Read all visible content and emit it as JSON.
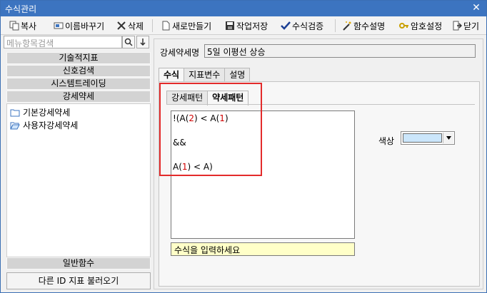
{
  "window": {
    "title": "수식관리"
  },
  "toolbar": {
    "copy": "복사",
    "rename": "이름바꾸기",
    "delete": "삭제",
    "new": "새로만들기",
    "save": "작업저장",
    "validate": "수식검증",
    "func_help": "함수설명",
    "password": "암호설정",
    "close": "닫기"
  },
  "search": {
    "placeholder": "메뉴항목검색"
  },
  "categories": [
    "기술적지표",
    "신호검색",
    "시스템트레이딩",
    "강세약세"
  ],
  "tree": [
    {
      "label": "기본강세약세"
    },
    {
      "label": "사용자강세약세"
    }
  ],
  "bottom_category": "일반함수",
  "load_button": "다른 ID 지표 불러오기",
  "editor": {
    "name_label": "강세약세명",
    "name_value": "5일 이평선 상승",
    "tabs": [
      "수식",
      "지표변수",
      "설명"
    ],
    "active_tab": "수식",
    "subtabs": [
      "강세패턴",
      "약세패턴"
    ],
    "active_subtab": "약세패턴",
    "formula_lines": [
      {
        "pre": "!(A(",
        "num": "2",
        "post": ") < A(",
        "num2": "1",
        "end": ")"
      },
      {
        "text": ""
      },
      {
        "text": "&&"
      },
      {
        "text": ""
      },
      {
        "pre": "A(",
        "num": "1",
        "post": ") < A)"
      }
    ],
    "hint": "수식을 입력하세요",
    "color_label": "색상",
    "color_value": "#cbe6fb"
  },
  "colors": {
    "titlebar": "#3c74c0",
    "highlight": "#e32b2b",
    "number": "#d10000"
  }
}
